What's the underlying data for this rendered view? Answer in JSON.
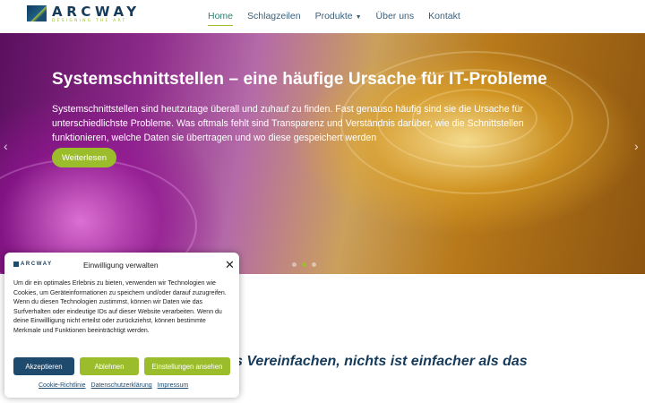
{
  "brand": {
    "name": "ARCWAY",
    "tagline": "DESIGNING THE ART"
  },
  "nav": {
    "items": [
      {
        "label": "Home",
        "active": true
      },
      {
        "label": "Schlagzeilen"
      },
      {
        "label": "Produkte",
        "dropdown": true
      },
      {
        "label": "Über uns"
      },
      {
        "label": "Kontakt"
      }
    ]
  },
  "hero": {
    "title": "Systemschnittstellen – eine häufige Ursache für IT-Probleme",
    "text": "Systemschnittstellen sind heutzutage überall und zuhauf zu finden. Fast genauso häufig sind sie die Ursache für unterschiedlichste Probleme. Was oftmals fehlt sind Transparenz und Verständnis darüber, wie die Schnittstellen funktionieren, welche Daten sie übertragen und wo diese gespeichert werden",
    "button_label": "Weiterlesen",
    "prev_glyph": "‹",
    "next_glyph": "›",
    "slide_count": 3,
    "active_slide": 2
  },
  "section": {
    "partial_heading": "s Vereinfachen, nichts ist einfacher als das"
  },
  "consent": {
    "logo_text": "ARCWAY",
    "title": "Einwilligung verwalten",
    "close_glyph": "✕",
    "text": "Um dir ein optimales Erlebnis zu bieten, verwenden wir Technologien wie Cookies, um Geräteinformationen zu speichern und/oder darauf zuzugreifen. Wenn du diesen Technologien zustimmst, können wir Daten wie das Surfverhalten oder eindeutige IDs auf dieser Website verarbeiten. Wenn du deine Einwillligung nicht erteilst oder zurückziehst, können bestimmte Merkmale und Funktionen beeinträchtigt werden.",
    "accept_label": "Akzeptieren",
    "deny_label": "Ablehnen",
    "prefs_label": "Einstellungen ansehen",
    "links": [
      "Cookie-Richtlinie",
      "Datenschutzerklärung",
      "Impressum"
    ]
  },
  "colors": {
    "accent_green": "#9bbd2c",
    "brand_blue": "#1e4a6e",
    "nav_active": "#2e7f6e"
  },
  "icons": {
    "caret": "chevron-down-icon",
    "close": "close-icon",
    "prev": "chevron-left-icon",
    "next": "chevron-right-icon"
  }
}
